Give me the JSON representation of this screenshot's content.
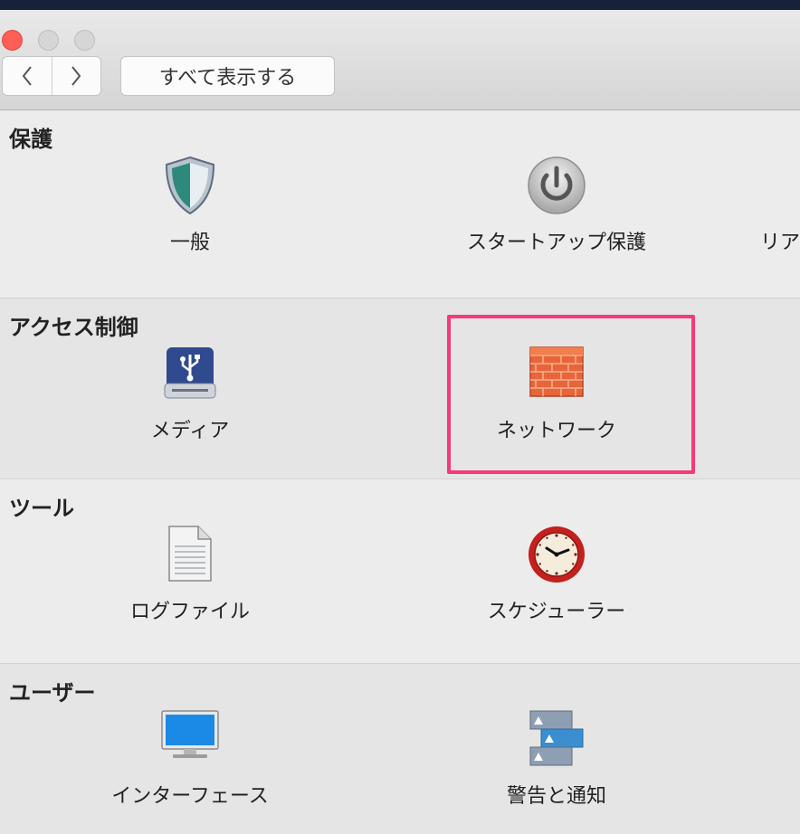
{
  "toolbar": {
    "back_icon": "chevron-left-icon",
    "forward_icon": "chevron-right-icon",
    "show_all_label": "すべて表示する"
  },
  "sections": [
    {
      "title": "保護",
      "items": [
        {
          "label": "一般",
          "icon": "shield-icon"
        },
        {
          "label": "スタートアップ保護",
          "icon": "power-icon"
        },
        {
          "label": "リア",
          "icon": ""
        }
      ]
    },
    {
      "title": "アクセス制御",
      "items": [
        {
          "label": "メディア",
          "icon": "usb-drive-icon"
        },
        {
          "label": "ネットワーク",
          "icon": "firewall-icon"
        }
      ]
    },
    {
      "title": "ツール",
      "items": [
        {
          "label": "ログファイル",
          "icon": "document-icon"
        },
        {
          "label": "スケジューラー",
          "icon": "clock-icon"
        }
      ]
    },
    {
      "title": "ユーザー",
      "items": [
        {
          "label": "インターフェース",
          "icon": "monitor-icon"
        },
        {
          "label": "警告と通知",
          "icon": "alerts-icon"
        }
      ]
    }
  ],
  "colors": {
    "highlight": "#f53a78",
    "close_button": "#ff5f57"
  }
}
